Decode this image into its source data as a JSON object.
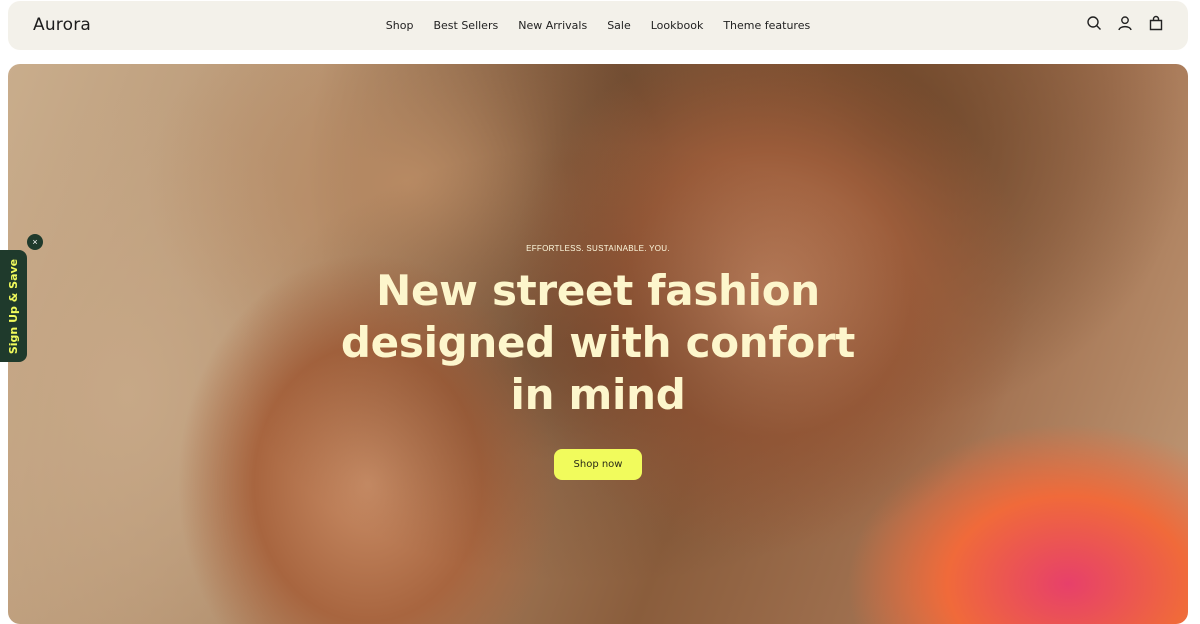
{
  "header": {
    "logo": "Aurora",
    "nav": [
      "Shop",
      "Best Sellers",
      "New Arrivals",
      "Sale",
      "Lookbook",
      "Theme features"
    ],
    "icons": [
      "search-icon",
      "account-icon",
      "cart-icon"
    ]
  },
  "hero": {
    "eyebrow": "EFFORTLESS. SUSTAINABLE. YOU.",
    "headline": "New street fashion designed with confort in mind",
    "cta": "Shop now"
  },
  "signup": {
    "label": "Sign Up & Save",
    "close": "×"
  },
  "colors": {
    "accent": "#f1fb5c",
    "header_bg": "#f3f1ea",
    "signup_bg": "#1f3a2c",
    "headline": "#fdf6cc"
  }
}
